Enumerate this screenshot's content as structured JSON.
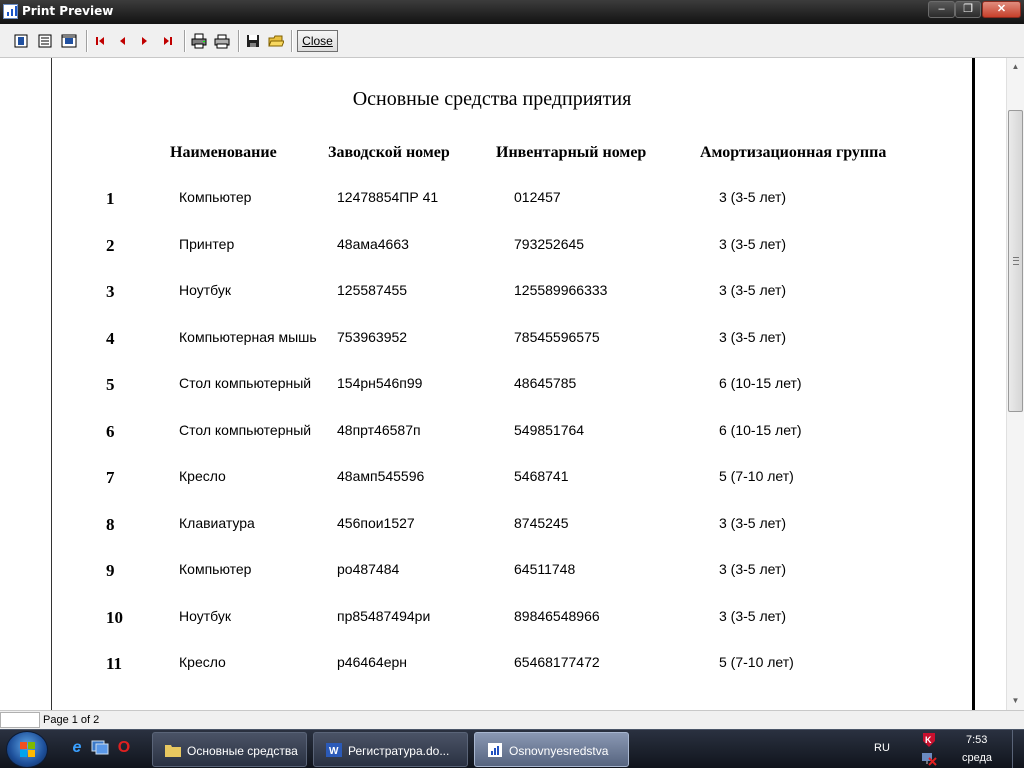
{
  "window": {
    "title": "Print Preview"
  },
  "window_controls": {
    "minimize": "‒",
    "maximize": "❐",
    "close": "✕"
  },
  "toolbar": {
    "close_label": "Close"
  },
  "document": {
    "title": "Основные средства предприятия",
    "columns": [
      "Наименование",
      "Заводской номер",
      "Инвентарный номер",
      "Амортизационная группа"
    ],
    "rows": [
      {
        "num": "1",
        "name": "Компьютер",
        "serial": "12478854ПР 41",
        "inventory": "012457",
        "group": "3 (3-5 лет)"
      },
      {
        "num": "2",
        "name": "Принтер",
        "serial": "48ама4663",
        "inventory": "793252645",
        "group": "3 (3-5 лет)"
      },
      {
        "num": "3",
        "name": "Ноутбук",
        "serial": "125587455",
        "inventory": "125589966333",
        "group": "3 (3-5 лет)"
      },
      {
        "num": "4",
        "name": "Компьютерная мышь",
        "serial": "753963952",
        "inventory": "78545596575",
        "group": "3 (3-5 лет)"
      },
      {
        "num": "5",
        "name": "Стол компьютерный",
        "serial": "154рн546п99",
        "inventory": "48645785",
        "group": "6 (10-15 лет)"
      },
      {
        "num": "6",
        "name": "Стол компьютерный",
        "serial": "48прт46587п",
        "inventory": "549851764",
        "group": "6 (10-15 лет)"
      },
      {
        "num": "7",
        "name": "Кресло",
        "serial": "48амп545596",
        "inventory": "5468741",
        "group": "5 (7-10 лет)"
      },
      {
        "num": "8",
        "name": "Клавиатура",
        "serial": "456пои1527",
        "inventory": "8745245",
        "group": "3 (3-5 лет)"
      },
      {
        "num": "9",
        "name": "Компьютер",
        "serial": "ро487484",
        "inventory": "64511748",
        "group": "3 (3-5 лет)"
      },
      {
        "num": "10",
        "name": "Ноутбук",
        "serial": "пр85487494ри",
        "inventory": "89846548966",
        "group": "3 (3-5 лет)"
      },
      {
        "num": "11",
        "name": "Кресло",
        "serial": "р46464ерн",
        "inventory": "65468177472",
        "group": "5 (7-10 лет)"
      }
    ]
  },
  "statusbar": {
    "page_info": "Page 1 of 2"
  },
  "taskbar": {
    "tasks": [
      {
        "label": "Основные средства",
        "active": false
      },
      {
        "label": "Регистратура.do...",
        "active": false
      },
      {
        "label": "Osnovnyesredstva",
        "active": true
      }
    ],
    "language": "RU",
    "time": "7:53",
    "day": "среда"
  },
  "colors": {
    "ie_blue": "#1f6fd6",
    "opera_red": "#d81e1e",
    "kaspersky_red": "#c8102e"
  },
  "icons": [
    "one-page-icon",
    "two-page-icon",
    "zoom-icon",
    "first-page-icon",
    "prev-page-icon",
    "next-page-icon",
    "last-page-icon",
    "print-setup-icon",
    "print-icon",
    "save-icon",
    "open-icon"
  ]
}
